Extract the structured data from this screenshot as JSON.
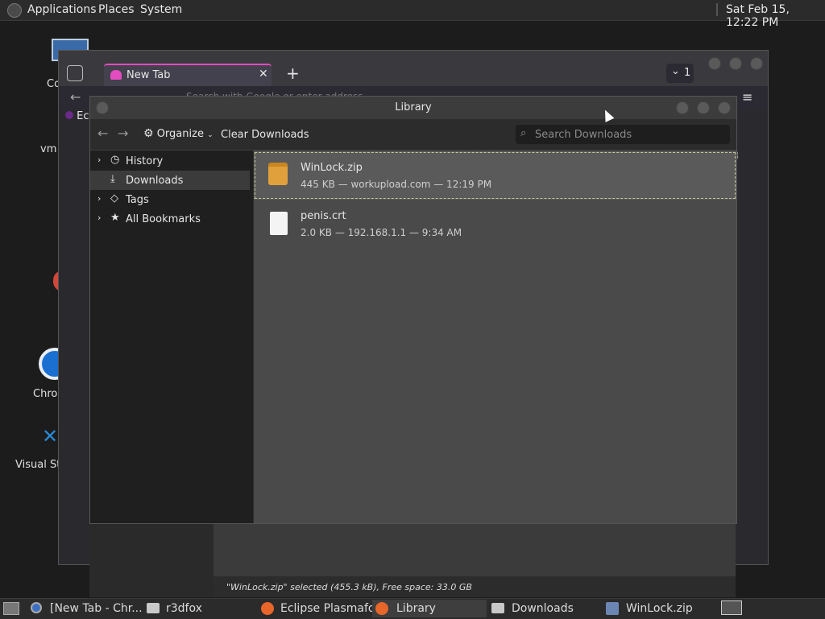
{
  "top_panel": {
    "menus": [
      "Applications",
      "Places",
      "System"
    ],
    "clock": "Sat Feb 15, 12:22 PM"
  },
  "desktop": {
    "icons": [
      {
        "label": "Co",
        "icon": "computer-icon"
      },
      {
        "label": "vm",
        "icon": "file-icon"
      },
      {
        "label": "Chro",
        "icon": "chrome-icon"
      },
      {
        "label": "Visual Stu",
        "icon": "vscode-icon"
      }
    ]
  },
  "firefox": {
    "tab_title": "New Tab",
    "tab_count": "1",
    "address_placeholder": "Search with Google or enter address",
    "bookmark_label": "Ec"
  },
  "library": {
    "title": "Library",
    "organize_label": "Organize",
    "clear_label": "Clear Downloads",
    "search_placeholder": "Search Downloads",
    "sidebar": [
      {
        "label": "History",
        "icon": "clock-icon",
        "expandable": true
      },
      {
        "label": "Downloads",
        "icon": "download-icon",
        "expandable": false
      },
      {
        "label": "Tags",
        "icon": "tag-icon",
        "expandable": true
      },
      {
        "label": "All Bookmarks",
        "icon": "star-icon",
        "expandable": true
      }
    ],
    "downloads": [
      {
        "name": "WinLock.zip",
        "meta": "445 KB — workupload.com — 12:19 PM",
        "icon": "zip-archive-icon"
      },
      {
        "name": "penis.crt",
        "meta": "2.0 KB — 192.168.1.1 — 9:34 AM",
        "icon": "document-icon"
      }
    ]
  },
  "status_text": "\"WinLock.zip\" selected (455.3 kB), Free space: 33.0 GB",
  "taskbar": {
    "items": [
      {
        "label": "[New Tab - Chr...",
        "icon": "chromium-icon"
      },
      {
        "label": "r3dfox",
        "icon": "folder-icon"
      },
      {
        "label": "Eclipse Plasmafox",
        "icon": "firefox-icon"
      },
      {
        "label": "Library",
        "icon": "firefox-icon"
      },
      {
        "label": "Downloads",
        "icon": "folder-icon"
      },
      {
        "label": "WinLock.zip",
        "icon": "archive-manager-icon"
      }
    ]
  }
}
